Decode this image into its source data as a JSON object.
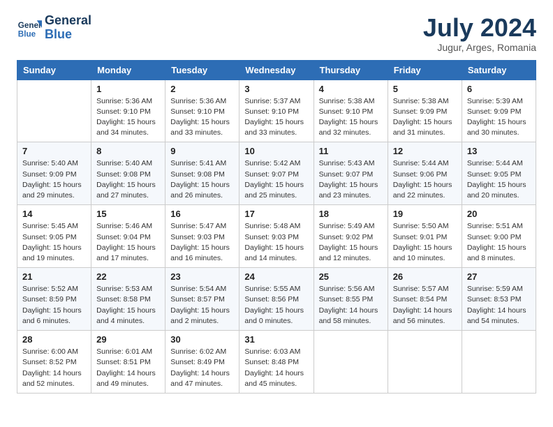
{
  "header": {
    "logo_line1": "General",
    "logo_line2": "Blue",
    "month_title": "July 2024",
    "location": "Jugur, Arges, Romania"
  },
  "weekdays": [
    "Sunday",
    "Monday",
    "Tuesday",
    "Wednesday",
    "Thursday",
    "Friday",
    "Saturday"
  ],
  "weeks": [
    [
      {
        "day": "",
        "info": ""
      },
      {
        "day": "1",
        "info": "Sunrise: 5:36 AM\nSunset: 9:10 PM\nDaylight: 15 hours\nand 34 minutes."
      },
      {
        "day": "2",
        "info": "Sunrise: 5:36 AM\nSunset: 9:10 PM\nDaylight: 15 hours\nand 33 minutes."
      },
      {
        "day": "3",
        "info": "Sunrise: 5:37 AM\nSunset: 9:10 PM\nDaylight: 15 hours\nand 33 minutes."
      },
      {
        "day": "4",
        "info": "Sunrise: 5:38 AM\nSunset: 9:10 PM\nDaylight: 15 hours\nand 32 minutes."
      },
      {
        "day": "5",
        "info": "Sunrise: 5:38 AM\nSunset: 9:09 PM\nDaylight: 15 hours\nand 31 minutes."
      },
      {
        "day": "6",
        "info": "Sunrise: 5:39 AM\nSunset: 9:09 PM\nDaylight: 15 hours\nand 30 minutes."
      }
    ],
    [
      {
        "day": "7",
        "info": "Sunrise: 5:40 AM\nSunset: 9:09 PM\nDaylight: 15 hours\nand 29 minutes."
      },
      {
        "day": "8",
        "info": "Sunrise: 5:40 AM\nSunset: 9:08 PM\nDaylight: 15 hours\nand 27 minutes."
      },
      {
        "day": "9",
        "info": "Sunrise: 5:41 AM\nSunset: 9:08 PM\nDaylight: 15 hours\nand 26 minutes."
      },
      {
        "day": "10",
        "info": "Sunrise: 5:42 AM\nSunset: 9:07 PM\nDaylight: 15 hours\nand 25 minutes."
      },
      {
        "day": "11",
        "info": "Sunrise: 5:43 AM\nSunset: 9:07 PM\nDaylight: 15 hours\nand 23 minutes."
      },
      {
        "day": "12",
        "info": "Sunrise: 5:44 AM\nSunset: 9:06 PM\nDaylight: 15 hours\nand 22 minutes."
      },
      {
        "day": "13",
        "info": "Sunrise: 5:44 AM\nSunset: 9:05 PM\nDaylight: 15 hours\nand 20 minutes."
      }
    ],
    [
      {
        "day": "14",
        "info": "Sunrise: 5:45 AM\nSunset: 9:05 PM\nDaylight: 15 hours\nand 19 minutes."
      },
      {
        "day": "15",
        "info": "Sunrise: 5:46 AM\nSunset: 9:04 PM\nDaylight: 15 hours\nand 17 minutes."
      },
      {
        "day": "16",
        "info": "Sunrise: 5:47 AM\nSunset: 9:03 PM\nDaylight: 15 hours\nand 16 minutes."
      },
      {
        "day": "17",
        "info": "Sunrise: 5:48 AM\nSunset: 9:03 PM\nDaylight: 15 hours\nand 14 minutes."
      },
      {
        "day": "18",
        "info": "Sunrise: 5:49 AM\nSunset: 9:02 PM\nDaylight: 15 hours\nand 12 minutes."
      },
      {
        "day": "19",
        "info": "Sunrise: 5:50 AM\nSunset: 9:01 PM\nDaylight: 15 hours\nand 10 minutes."
      },
      {
        "day": "20",
        "info": "Sunrise: 5:51 AM\nSunset: 9:00 PM\nDaylight: 15 hours\nand 8 minutes."
      }
    ],
    [
      {
        "day": "21",
        "info": "Sunrise: 5:52 AM\nSunset: 8:59 PM\nDaylight: 15 hours\nand 6 minutes."
      },
      {
        "day": "22",
        "info": "Sunrise: 5:53 AM\nSunset: 8:58 PM\nDaylight: 15 hours\nand 4 minutes."
      },
      {
        "day": "23",
        "info": "Sunrise: 5:54 AM\nSunset: 8:57 PM\nDaylight: 15 hours\nand 2 minutes."
      },
      {
        "day": "24",
        "info": "Sunrise: 5:55 AM\nSunset: 8:56 PM\nDaylight: 15 hours\nand 0 minutes."
      },
      {
        "day": "25",
        "info": "Sunrise: 5:56 AM\nSunset: 8:55 PM\nDaylight: 14 hours\nand 58 minutes."
      },
      {
        "day": "26",
        "info": "Sunrise: 5:57 AM\nSunset: 8:54 PM\nDaylight: 14 hours\nand 56 minutes."
      },
      {
        "day": "27",
        "info": "Sunrise: 5:59 AM\nSunset: 8:53 PM\nDaylight: 14 hours\nand 54 minutes."
      }
    ],
    [
      {
        "day": "28",
        "info": "Sunrise: 6:00 AM\nSunset: 8:52 PM\nDaylight: 14 hours\nand 52 minutes."
      },
      {
        "day": "29",
        "info": "Sunrise: 6:01 AM\nSunset: 8:51 PM\nDaylight: 14 hours\nand 49 minutes."
      },
      {
        "day": "30",
        "info": "Sunrise: 6:02 AM\nSunset: 8:49 PM\nDaylight: 14 hours\nand 47 minutes."
      },
      {
        "day": "31",
        "info": "Sunrise: 6:03 AM\nSunset: 8:48 PM\nDaylight: 14 hours\nand 45 minutes."
      },
      {
        "day": "",
        "info": ""
      },
      {
        "day": "",
        "info": ""
      },
      {
        "day": "",
        "info": ""
      }
    ]
  ]
}
